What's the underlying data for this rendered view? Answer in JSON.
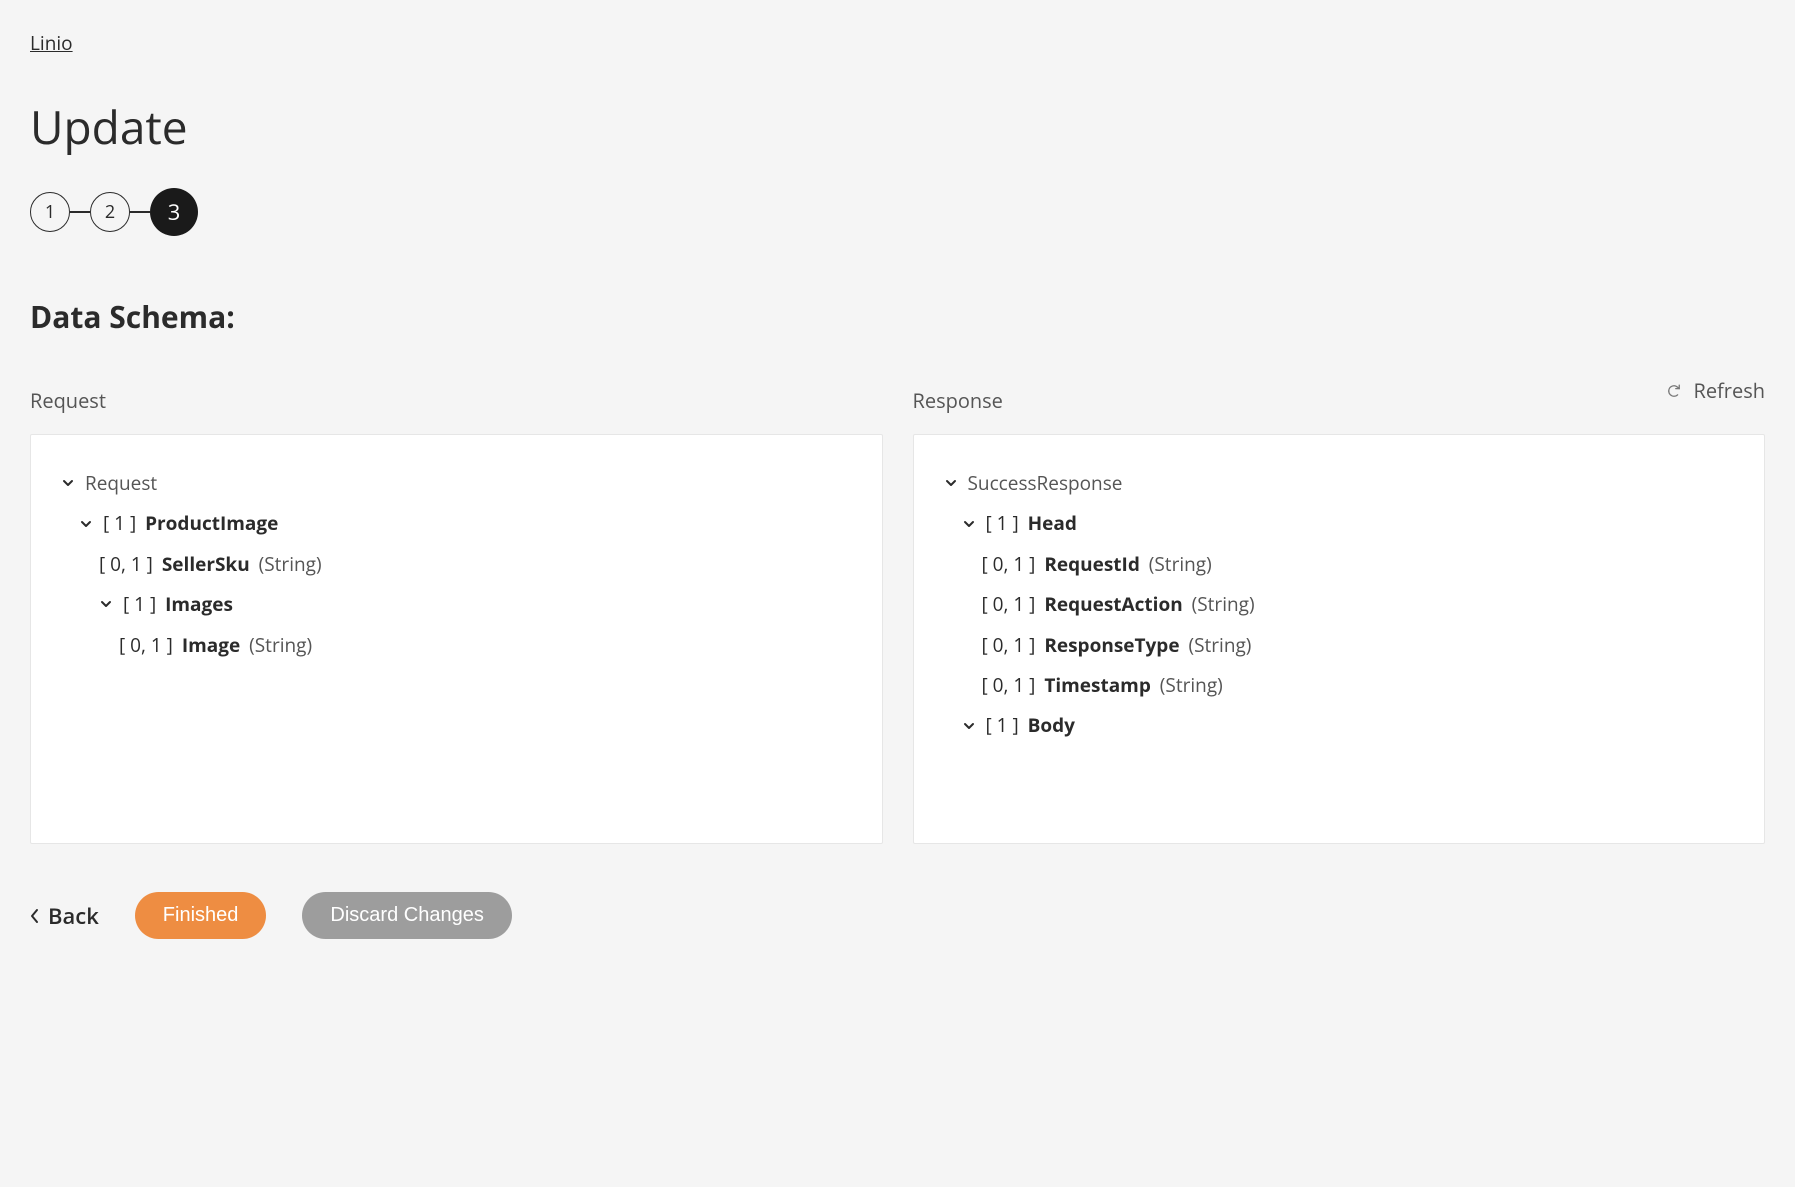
{
  "breadcrumb": "Linio",
  "page_title": "Update",
  "stepper": {
    "steps": [
      "1",
      "2",
      "3"
    ],
    "active_index": 2
  },
  "section_title": "Data Schema:",
  "refresh_label": "Refresh",
  "request": {
    "label": "Request",
    "root": "Request",
    "tree": [
      {
        "indent": 1,
        "expandable": true,
        "count": "[ 1 ]",
        "name": "ProductImage",
        "type": ""
      },
      {
        "indent": 2,
        "expandable": false,
        "count": "[ 0, 1 ]",
        "name": "SellerSku",
        "type": "(String)"
      },
      {
        "indent": 2,
        "expandable": true,
        "count": "[ 1 ]",
        "name": "Images",
        "type": ""
      },
      {
        "indent": 3,
        "expandable": false,
        "count": "[ 0, 1 ]",
        "name": "Image",
        "type": "(String)"
      }
    ]
  },
  "response": {
    "label": "Response",
    "root": "SuccessResponse",
    "tree": [
      {
        "indent": 1,
        "expandable": true,
        "count": "[ 1 ]",
        "name": "Head",
        "type": ""
      },
      {
        "indent": 2,
        "expandable": false,
        "count": "[ 0, 1 ]",
        "name": "RequestId",
        "type": "(String)"
      },
      {
        "indent": 2,
        "expandable": false,
        "count": "[ 0, 1 ]",
        "name": "RequestAction",
        "type": "(String)"
      },
      {
        "indent": 2,
        "expandable": false,
        "count": "[ 0, 1 ]",
        "name": "ResponseType",
        "type": "(String)"
      },
      {
        "indent": 2,
        "expandable": false,
        "count": "[ 0, 1 ]",
        "name": "Timestamp",
        "type": "(String)"
      },
      {
        "indent": 1,
        "expandable": true,
        "count": "[ 1 ]",
        "name": "Body",
        "type": ""
      }
    ]
  },
  "footer": {
    "back": "Back",
    "finished": "Finished",
    "discard": "Discard Changes"
  }
}
